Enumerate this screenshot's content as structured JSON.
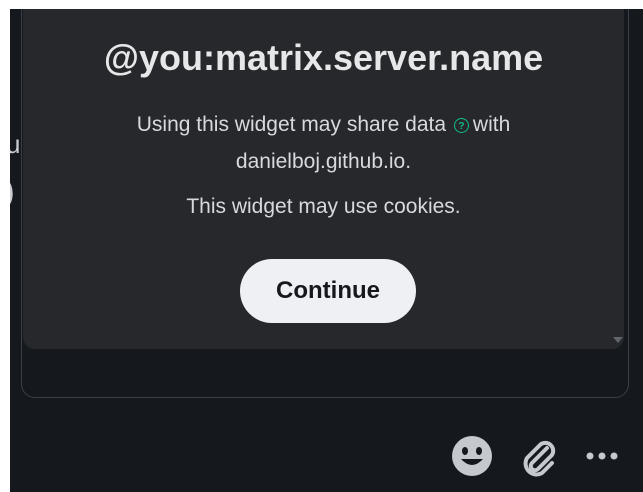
{
  "left_pane": {
    "fragment_letter": "u",
    "fragment_symbol": ")"
  },
  "widget": {
    "user_id": "@you:matrix.server.name",
    "share_prefix": "Using this widget may share data",
    "share_suffix": "with",
    "host": "danielboj.github.io.",
    "cookies_notice": "This widget may use cookies.",
    "continue_label": "Continue",
    "help_icon_glyph": "?"
  },
  "composer": {
    "icons": [
      "emoji-icon",
      "attachment-icon",
      "more-options-icon"
    ]
  },
  "colors": {
    "background": "#15191e",
    "card": "#27282b",
    "accent": "#0dbd8b",
    "button": "#eef0f3",
    "icon": "#c5c8cc"
  }
}
